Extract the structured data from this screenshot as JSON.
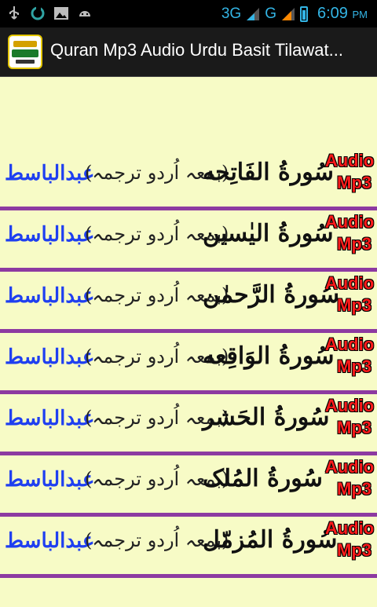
{
  "status_bar": {
    "network_1": "3G",
    "network_2": "G",
    "time": "6:09",
    "ampm": "PM",
    "icons": [
      "usb-icon",
      "sync-icon",
      "image-icon",
      "android-icon"
    ]
  },
  "action_bar": {
    "title": "Quran Mp3 Audio Urdu Basit Tilawat..."
  },
  "badge": {
    "line1": "Audio",
    "line2": "Mp3"
  },
  "list": {
    "items": [
      {
        "surah": "سُورةُ الفَاتِحه",
        "translation": "(بمعہ اُردو ترجمہ)",
        "author": "عبدالباسط"
      },
      {
        "surah": "سُورةُ الیٰسین",
        "translation": "(بمعہ اُردو ترجمہ)",
        "author": "عبدالباسط"
      },
      {
        "surah": "سُورةُ الرَّحمٰن",
        "translation": "(بمعہ اُردو ترجمہ)",
        "author": "عبدالباسط"
      },
      {
        "surah": "سُورةُ الوَاقِعه",
        "translation": "(بمعہ اُردو ترجمہ)",
        "author": "عبدالباسط"
      },
      {
        "surah": "سُورةُ الحَشر",
        "translation": "(بمعہ اُردو ترجمہ)",
        "author": "عبدالباسط"
      },
      {
        "surah": "سُورةُ المُلک",
        "translation": "(بمعہ اُردو ترجمہ)",
        "author": "عبدالباسط"
      },
      {
        "surah": "سُورةُ المُزمّل",
        "translation": "(بمعہ اُردو ترجمہ)",
        "author": "عبدالباسط"
      }
    ]
  }
}
